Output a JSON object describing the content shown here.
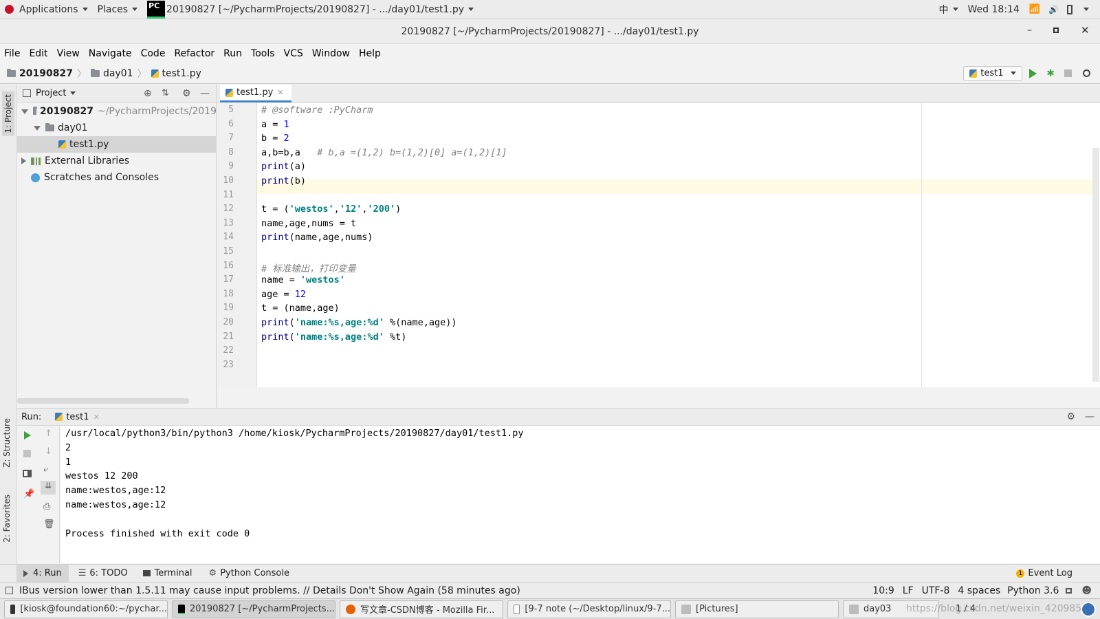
{
  "system_bar": {
    "applications": "Applications",
    "places": "Places",
    "app_title": "20190827 [~/PycharmProjects/20190827] - .../day01/test1.py",
    "input_method": "中",
    "clock": "Wed 18:14"
  },
  "window": {
    "title": "20190827 [~/PycharmProjects/20190827] - .../day01/test1.py"
  },
  "menu": [
    "File",
    "Edit",
    "View",
    "Navigate",
    "Code",
    "Refactor",
    "Run",
    "Tools",
    "VCS",
    "Window",
    "Help"
  ],
  "breadcrumb": {
    "project": "20190827",
    "folder": "day01",
    "file": "test1.py"
  },
  "run_config": "test1",
  "left_strip": {
    "project": "1: Project",
    "structure": "Z: Structure",
    "favorites": "2: Favorites"
  },
  "project_panel": {
    "title": "Project",
    "root": "20190827",
    "root_path": "~/PycharmProjects/2019",
    "folder": "day01",
    "file": "test1.py",
    "external": "External Libraries",
    "scratches": "Scratches and Consoles"
  },
  "editor": {
    "tab": "test1.py",
    "lines": [
      {
        "n": "5",
        "segs": [
          {
            "t": "# @software :PyCharm",
            "c": "cmt"
          }
        ]
      },
      {
        "n": "6",
        "segs": [
          {
            "t": "a = ",
            "c": ""
          },
          {
            "t": "1",
            "c": "num"
          }
        ]
      },
      {
        "n": "7",
        "segs": [
          {
            "t": "b = ",
            "c": ""
          },
          {
            "t": "2",
            "c": "num"
          }
        ]
      },
      {
        "n": "8",
        "segs": [
          {
            "t": "a,b=b,a   ",
            "c": ""
          },
          {
            "t": "# b,a =(1,2) b=(1,2)[0] a=(1,2)[1]",
            "c": "cmt"
          }
        ]
      },
      {
        "n": "9",
        "segs": [
          {
            "t": "print",
            "c": "kw"
          },
          {
            "t": "(a)",
            "c": ""
          }
        ]
      },
      {
        "n": "10",
        "segs": [
          {
            "t": "print",
            "c": "kw"
          },
          {
            "t": "(b)",
            "c": ""
          }
        ]
      },
      {
        "n": "11",
        "segs": []
      },
      {
        "n": "12",
        "segs": [
          {
            "t": "t = (",
            "c": ""
          },
          {
            "t": "'westos'",
            "c": "str"
          },
          {
            "t": ",",
            "c": ""
          },
          {
            "t": "'12'",
            "c": "str"
          },
          {
            "t": ",",
            "c": ""
          },
          {
            "t": "'200'",
            "c": "str"
          },
          {
            "t": ")",
            "c": ""
          }
        ]
      },
      {
        "n": "13",
        "segs": [
          {
            "t": "name,age,nums = t",
            "c": ""
          }
        ]
      },
      {
        "n": "14",
        "segs": [
          {
            "t": "print",
            "c": "kw"
          },
          {
            "t": "(name,age,nums)",
            "c": ""
          }
        ]
      },
      {
        "n": "15",
        "segs": []
      },
      {
        "n": "16",
        "segs": [
          {
            "t": "# 标准输出，打印变量",
            "c": "cmt"
          }
        ]
      },
      {
        "n": "17",
        "segs": [
          {
            "t": "name = ",
            "c": ""
          },
          {
            "t": "'westos'",
            "c": "str"
          }
        ]
      },
      {
        "n": "18",
        "segs": [
          {
            "t": "age = ",
            "c": ""
          },
          {
            "t": "12",
            "c": "num"
          }
        ]
      },
      {
        "n": "19",
        "segs": [
          {
            "t": "t = (name,age)",
            "c": ""
          }
        ]
      },
      {
        "n": "20",
        "segs": [
          {
            "t": "print",
            "c": "kw"
          },
          {
            "t": "(",
            "c": ""
          },
          {
            "t": "'name:%s,age:%d'",
            "c": "str"
          },
          {
            "t": " %(name,age))",
            "c": ""
          }
        ]
      },
      {
        "n": "21",
        "segs": [
          {
            "t": "print",
            "c": "kw"
          },
          {
            "t": "(",
            "c": ""
          },
          {
            "t": "'name:%s,age:%d'",
            "c": "str"
          },
          {
            "t": " %t)",
            "c": ""
          }
        ]
      },
      {
        "n": "22",
        "segs": []
      },
      {
        "n": "23",
        "segs": []
      }
    ]
  },
  "run_panel": {
    "label": "Run:",
    "config": "test1",
    "output": [
      {
        "t": "/usr/local/python3/bin/python3 /home/kiosk/PycharmProjects/20190827/day01/test1.py",
        "c": "kw"
      },
      {
        "t": "2",
        "c": ""
      },
      {
        "t": "1",
        "c": ""
      },
      {
        "t": "westos 12 200",
        "c": ""
      },
      {
        "t": "name:westos,age:12",
        "c": ""
      },
      {
        "t": "name:westos,age:12",
        "c": ""
      },
      {
        "t": "",
        "c": ""
      },
      {
        "t": "Process finished with exit code 0",
        "c": "kw"
      }
    ]
  },
  "bottom_tabs": {
    "run": "4: Run",
    "todo": "6: TODO",
    "terminal": "Terminal",
    "python_console": "Python Console",
    "event_log": "Event Log",
    "event_count": "1"
  },
  "status": {
    "message": "IBus version lower than 1.5.11 may cause input problems. // Details   Don't Show Again (58 minutes ago)",
    "position": "10:9",
    "line_sep": "LF",
    "encoding": "UTF-8",
    "indent": "4 spaces",
    "interpreter": "Python 3.6"
  },
  "taskbar": {
    "items": [
      "[kiosk@foundation60:~/pychar...",
      "20190827 [~/PycharmProjects...",
      "写文章-CSDN博客 - Mozilla Fir...",
      "[9-7 note (~/Desktop/linux/9-7...",
      "[Pictures]",
      "day03"
    ],
    "pager": "1 / 4",
    "watermark": "https://blog.csdn.net/weixin_42098559"
  },
  "colors": {
    "accent": "#4083c9",
    "run_green": "#3aa43a",
    "caret_line": "#fffae3"
  }
}
